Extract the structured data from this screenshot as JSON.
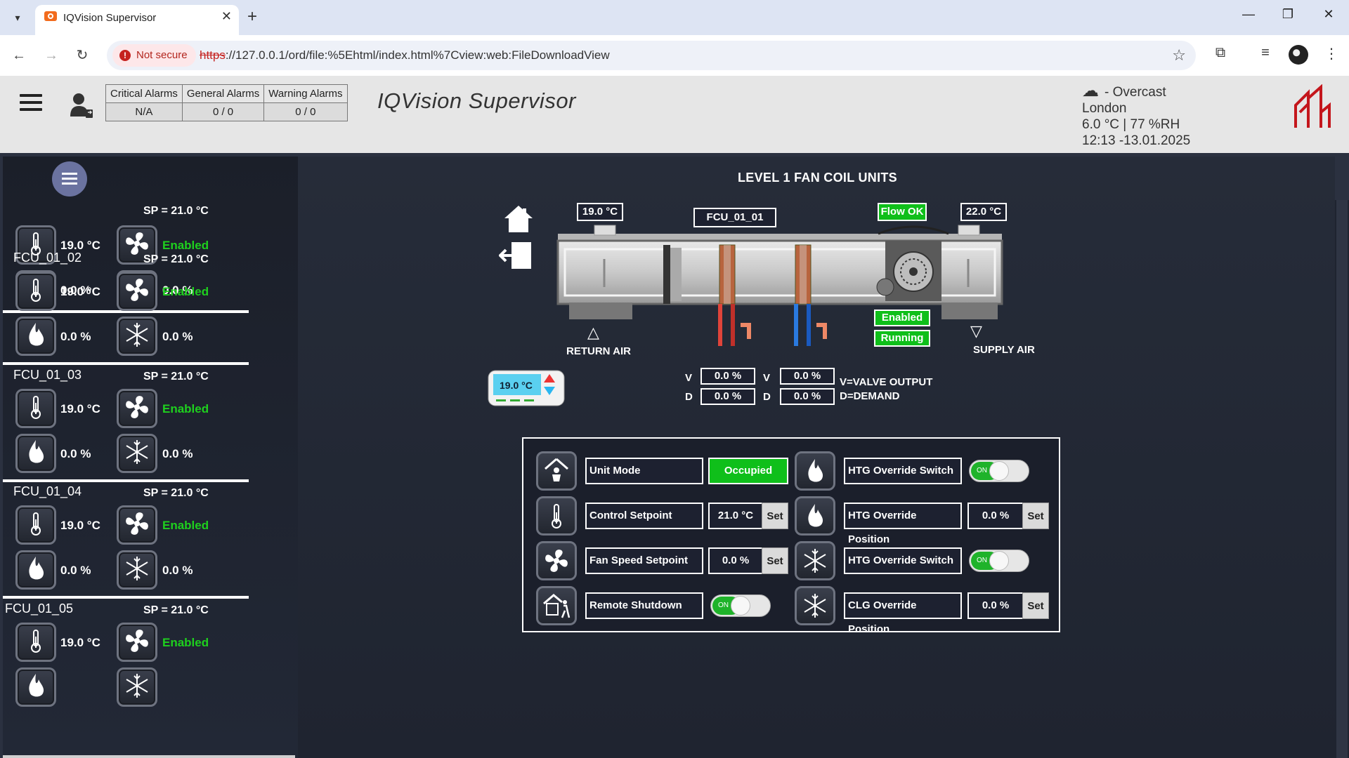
{
  "browser": {
    "tab_title": "IQVision Supervisor",
    "not_secure": "Not secure",
    "url_scheme": "https",
    "url_rest": "://127.0.0.1/ord/file:%5Ehtml/index.html%7Cview:web:FileDownloadView"
  },
  "header": {
    "alarms": {
      "headers": [
        "Critical Alarms",
        "General Alarms",
        "Warning Alarms"
      ],
      "values": [
        "N/A",
        "0 / 0",
        "0 / 0"
      ]
    },
    "title": "IQVision Supervisor",
    "weather": {
      "condition": "- Overcast",
      "city": "London",
      "reading": "6.0 °C | 77 %RH",
      "datetime": "12:13 -13.01.2025"
    }
  },
  "sidebar": {
    "units": [
      {
        "name": "",
        "sp": "SP = 21.0 °C",
        "temp": "19.0 °C",
        "fan": "Enabled",
        "heat": "0.0 %",
        "cool": "0.0 %"
      },
      {
        "name": "FCU_01_02",
        "sp": "SP = 21.0 °C",
        "temp": "19.0 °C",
        "fan": "Enabled",
        "heat": "0.0 %",
        "cool": "0.0 %"
      },
      {
        "name": "FCU_01_03",
        "sp": "SP = 21.0 °C",
        "temp": "19.0 °C",
        "fan": "Enabled",
        "heat": "0.0 %",
        "cool": "0.0 %"
      },
      {
        "name": "FCU_01_04",
        "sp": "SP = 21.0 °C",
        "temp": "19.0 °C",
        "fan": "Enabled",
        "heat": "0.0 %",
        "cool": "0.0 %"
      },
      {
        "name": "FCU_01_05",
        "sp": "SP = 21.0 °C",
        "temp": "19.0 °C",
        "fan": "Enabled",
        "heat": "",
        "cool": ""
      }
    ]
  },
  "main": {
    "title": "LEVEL 1 FAN COIL UNITS",
    "unit_name": "FCU_01_01",
    "return_temp": "19.0 °C",
    "supply_temp": "22.0 °C",
    "flow_status": "Flow OK",
    "fan_enabled": "Enabled",
    "fan_running": "Running",
    "return_air": "RETURN AIR",
    "supply_air": "SUPPLY AIR",
    "thermostat_temp": "19.0 °C",
    "v_label": "V",
    "d_label": "D",
    "heating_valve": "0.0 %",
    "heating_demand": "0.0 %",
    "cooling_valve": "0.0 %",
    "cooling_demand": "0.0 %",
    "legend_v": "V=VALVE OUTPUT",
    "legend_d": "D=DEMAND"
  },
  "panel": {
    "unit_mode_label": "Unit Mode",
    "unit_mode_value": "Occupied",
    "control_sp_label": "Control Setpoint",
    "control_sp_value": "21.0 °C",
    "fan_sp_label": "Fan Speed Setpoint",
    "fan_sp_value": "0.0 %",
    "remote_shutdown_label": "Remote Shutdown",
    "htg_switch_label": "HTG Override Switch",
    "htg_position_label": "HTG Override Position",
    "htg_position_value": "0.0 %",
    "htg_switch2_label": "HTG Override Switch",
    "clg_position_label": "CLG Override Position",
    "clg_position_value": "0.0 %",
    "set_label": "Set",
    "toggle_on": "ON"
  },
  "colors": {
    "green": "#0fbf1a",
    "enabled_text": "#1ed01e",
    "logo_red": "#c4161c",
    "bg_dark": "#262c39"
  }
}
